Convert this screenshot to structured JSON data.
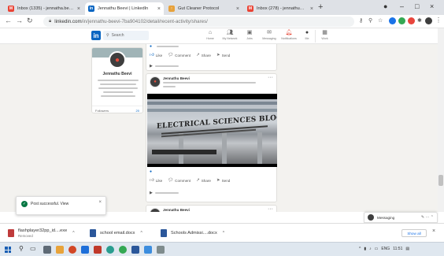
{
  "browser": {
    "tabs": [
      {
        "label": "Inbox (1335) - jennatha.beevi@...",
        "icon_color": "#ea4335",
        "active": false
      },
      {
        "label": "Jennathu Beevi | LinkedIn",
        "icon_color": "#0a66c2",
        "active": true
      },
      {
        "label": "Gut Cleaner Protocol",
        "icon_color": "#e7a23c",
        "active": false
      },
      {
        "label": "Inbox (278) - jennathu@gmail.c...",
        "icon_color": "#ea4335",
        "active": false
      }
    ],
    "url_host": "linkedin.com",
    "url_path": "/in/jennathu-beevi-7ba904102/detail/recent-activity/shares/"
  },
  "linkedin": {
    "logo": "in",
    "search_placeholder": "Search",
    "nav": [
      {
        "label": "Home",
        "icon": "home-icon"
      },
      {
        "label": "My Network",
        "icon": "network-icon"
      },
      {
        "label": "Jobs",
        "icon": "jobs-icon"
      },
      {
        "label": "Messaging",
        "icon": "messaging-icon"
      },
      {
        "label": "Notifications",
        "icon": "bell-icon"
      },
      {
        "label": "Me",
        "icon": "me-icon"
      },
      {
        "label": "Work",
        "icon": "grid-icon"
      }
    ],
    "premium": ""
  },
  "profile": {
    "name": "Jennathu Beevi",
    "headline": "",
    "followers_label": "Followers",
    "followers_count": "20"
  },
  "feed": {
    "post1": {
      "top_line": "",
      "actions": [
        "Like",
        "Comment",
        "Share",
        "Send"
      ],
      "views": ""
    },
    "post2": {
      "author": "Jennathu Beevi",
      "video_sign": "ELECTRICAL SCIENCES BLOCK",
      "actions": [
        "Like",
        "Comment",
        "Share",
        "Send"
      ],
      "views": ""
    },
    "post3": {
      "author": "Jennathu Beevi"
    }
  },
  "toast": {
    "message": "Post successful. View",
    "sub": "",
    "page": ""
  },
  "messaging": {
    "label": "Messaging"
  },
  "downloads": [
    {
      "name": "flashplayer32pp_id....exe",
      "status": "Removed",
      "icon_color": "#bf3b3b"
    },
    {
      "name": "school email.docx",
      "status": "",
      "icon_color": "#2b579a"
    },
    {
      "name": "Schools Admissi....docx",
      "status": "",
      "icon_color": "#2b579a"
    }
  ],
  "shelf": {
    "show_all": "Show all"
  },
  "tray": {
    "lang": "ENG",
    "time": "11:51"
  }
}
